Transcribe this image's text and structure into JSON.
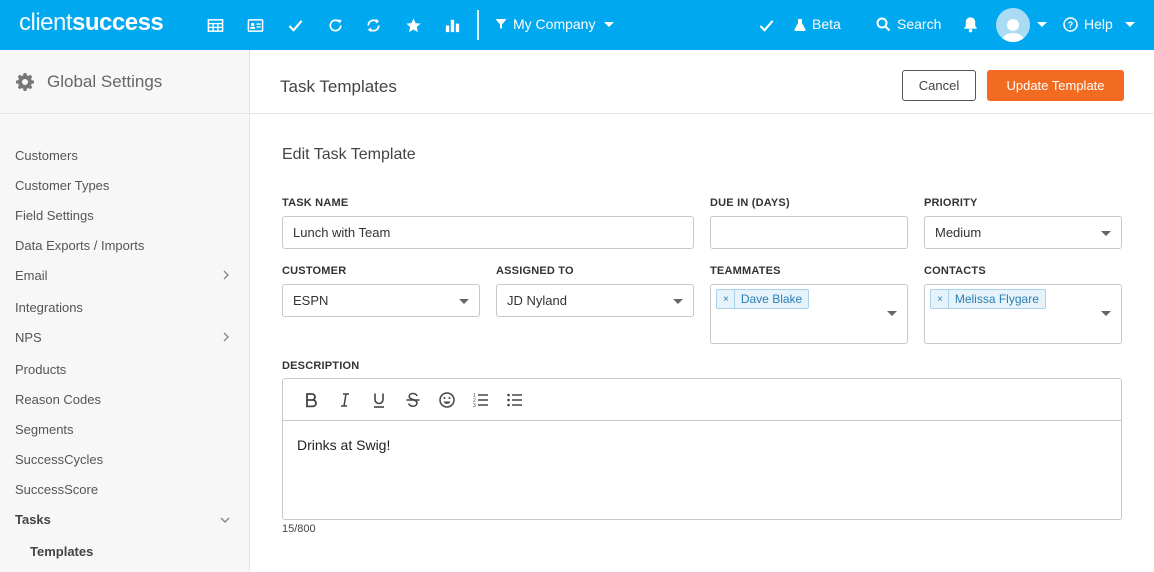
{
  "brand": {
    "part1": "client",
    "part2": "success"
  },
  "topbar": {
    "company": "My Company",
    "beta": "Beta",
    "search": "Search",
    "help": "Help"
  },
  "sidebar": {
    "title": "Global Settings",
    "items": [
      {
        "label": "Customers",
        "chevron": ""
      },
      {
        "label": "Customer Types",
        "chevron": ""
      },
      {
        "label": "Field Settings",
        "chevron": ""
      },
      {
        "label": "Data Exports / Imports",
        "chevron": ""
      },
      {
        "label": "Email",
        "chevron": "right"
      },
      {
        "label": "Integrations",
        "chevron": ""
      },
      {
        "label": "NPS",
        "chevron": "right"
      },
      {
        "label": "Products",
        "chevron": ""
      },
      {
        "label": "Reason Codes",
        "chevron": ""
      },
      {
        "label": "Segments",
        "chevron": ""
      },
      {
        "label": "SuccessCycles",
        "chevron": ""
      },
      {
        "label": "SuccessScore",
        "chevron": ""
      },
      {
        "label": "Tasks",
        "chevron": "down"
      },
      {
        "label": "Templates",
        "chevron": ""
      }
    ]
  },
  "header": {
    "title": "Task Templates",
    "cancel": "Cancel",
    "update": "Update Template"
  },
  "form": {
    "title": "Edit Task Template",
    "task_name": {
      "label": "TASK NAME",
      "value": "Lunch with Team"
    },
    "due_in": {
      "label": "DUE IN (DAYS)",
      "value": ""
    },
    "priority": {
      "label": "PRIORITY",
      "value": "Medium"
    },
    "customer": {
      "label": "CUSTOMER",
      "value": "ESPN"
    },
    "assigned_to": {
      "label": "ASSIGNED TO",
      "value": "JD Nyland"
    },
    "teammates": {
      "label": "TEAMMATES",
      "tag": "Dave Blake",
      "remove": "×"
    },
    "contacts": {
      "label": "CONTACTS",
      "tag": "Melissa Flygare",
      "remove": "×"
    },
    "description": {
      "label": "DESCRIPTION",
      "value": "Drinks at Swig!",
      "counter": "15/800"
    }
  },
  "colors": {
    "topbar": "#00a8f0",
    "primary_button": "#f26b21",
    "tag_bg": "#e6f3fb",
    "tag_text": "#2a7fb5"
  }
}
